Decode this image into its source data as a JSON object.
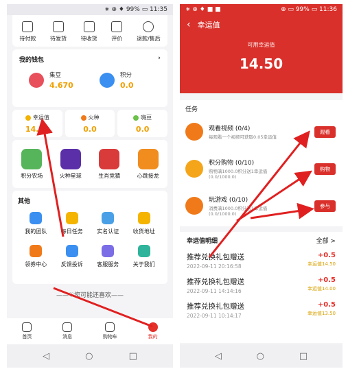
{
  "left_phone": {
    "status": {
      "right": "∗ ⊕ ♦ 99% ▭ 11:35"
    },
    "orders": [
      "待付款",
      "待发货",
      "待收货",
      "评价",
      "退款/售后"
    ],
    "wallet": {
      "title": "我的钱包",
      "items": [
        {
          "label": "集豆",
          "value": "4.670",
          "color": "#e8505b"
        },
        {
          "label": "积分",
          "value": "0.0",
          "color": "#3a8ff0"
        }
      ]
    },
    "balances": [
      {
        "label": "幸运值",
        "value": "14.50",
        "color": "#f2b400"
      },
      {
        "label": "火种",
        "value": "0.0",
        "color": "#f07a1a"
      },
      {
        "label": "嗨豆",
        "value": "0.0",
        "color": "#6cc24a"
      }
    ],
    "games": [
      {
        "label": "积分农场",
        "color": "#56b55a"
      },
      {
        "label": "火种星球",
        "color": "#5b2fa8"
      },
      {
        "label": "生肖竞猜",
        "color": "#d93a3a"
      },
      {
        "label": "心跳接龙",
        "color": "#f08d1e"
      }
    ],
    "other": {
      "title": "其他",
      "items": [
        {
          "label": "我的团队",
          "color": "#3a8ff0"
        },
        {
          "label": "每日任务",
          "color": "#f4b400"
        },
        {
          "label": "实名认证",
          "color": "#4aa0e6"
        },
        {
          "label": "收货地址",
          "color": "#f4b400"
        },
        {
          "label": "领券中心",
          "color": "#f07a1a"
        },
        {
          "label": "反馈投诉",
          "color": "#3a8ff0"
        },
        {
          "label": "客服服务",
          "color": "#7b6de6"
        },
        {
          "label": "关于我们",
          "color": "#2fb39b"
        }
      ]
    },
    "like_text": "——♡您可能还喜欢——",
    "tabs": [
      {
        "label": "首页",
        "active": false
      },
      {
        "label": "消息",
        "active": false
      },
      {
        "label": "购物车",
        "active": false
      },
      {
        "label": "我的",
        "active": true
      }
    ]
  },
  "right_phone": {
    "status": {
      "left": "∗ ⊕ ♦ ■ ■",
      "right": "⊕ ▭ 99% ▭ 11:36"
    },
    "header": {
      "title": "幸运值",
      "subtitle": "可用幸运值",
      "value": "14.50"
    },
    "tasks": {
      "title": "任务",
      "items": [
        {
          "name": "观看视频 (0/4)",
          "desc": "每观看一个视频可获取0.05幸运值",
          "button": "观看",
          "color": "#f07a1a"
        },
        {
          "name": "积分购物 (0/10)",
          "desc": "购物满1000.0积分送1幸运值\n(0.0/1000.0)",
          "button": "购物",
          "color": "#f4a51a"
        },
        {
          "name": "玩游戏 (0/10)",
          "desc": "消费满1000.0积分送1幸运值\n(0.0/1000.0)",
          "button": "参与",
          "color": "#f07a1a"
        }
      ]
    },
    "detail": {
      "title": "幸运值明细",
      "all_label": "全部 >",
      "records": [
        {
          "name": "推荐兑换礼包赠送",
          "date": "2022-09-11 20:16:58",
          "amount": "+0.5",
          "balance": "幸运值14.50"
        },
        {
          "name": "推荐兑换礼包赠送",
          "date": "2022-09-11 14:14:16",
          "amount": "+0.5",
          "balance": "幸运值14.00"
        },
        {
          "name": "推荐兑换礼包赠送",
          "date": "2022-09-11 10:14:17",
          "amount": "+0.5",
          "balance": "幸运值13.50"
        }
      ]
    }
  },
  "navbar": {
    "back": "◁",
    "home": "○",
    "recent": "□"
  },
  "accent": "#d9302b"
}
